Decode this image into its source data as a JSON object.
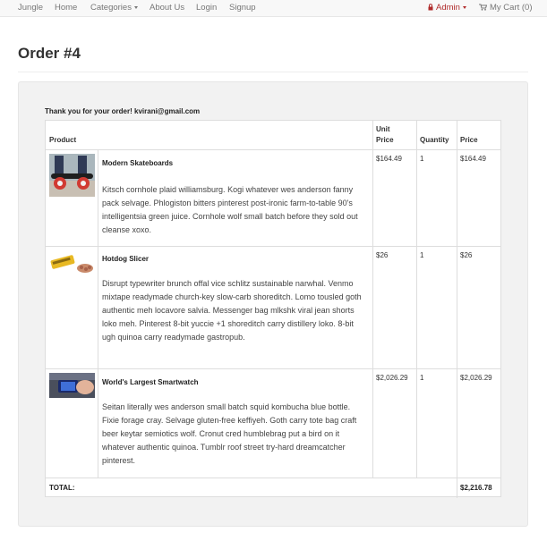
{
  "navbar": {
    "brand": "Jungle",
    "home": "Home",
    "categories": "Categories",
    "about": "About Us",
    "login": "Login",
    "signup": "Signup",
    "admin": "Admin",
    "cart": "My Cart (0)"
  },
  "page": {
    "title": "Order #4"
  },
  "order": {
    "thanks": "Thank you for your order! kvirani@gmail.com",
    "headers": {
      "product": "Product",
      "unit_price_line1": "Unit",
      "unit_price_line2": "Price",
      "quantity": "Quantity",
      "price": "Price"
    },
    "items": [
      {
        "name": "Modern Skateboards",
        "description": "Kitsch cornhole plaid williamsburg. Kogi whatever wes anderson fanny pack selvage. Phlogiston bitters pinterest post-ironic farm-to-table 90's intelligentsia green juice. Cornhole wolf small batch before they sold out cleanse xoxo.",
        "unit_price": "$164.49",
        "quantity": "1",
        "price": "$164.49",
        "image_icon": "skateboard-product-image"
      },
      {
        "name": "Hotdog Slicer",
        "description": "Disrupt typewriter brunch offal vice schlitz sustainable narwhal. Venmo mixtape readymade church-key slow-carb shoreditch. Lomo tousled goth authentic meh locavore salvia. Messenger bag mlkshk viral jean shorts loko meh. Pinterest 8-bit yuccie +1 shoreditch carry distillery loko. 8-bit ugh quinoa carry readymade gastropub.",
        "unit_price": "$26",
        "quantity": "1",
        "price": "$26",
        "image_icon": "hotdog-slicer-product-image"
      },
      {
        "name": "World's Largest Smartwatch",
        "description": "Seitan literally wes anderson small batch squid kombucha blue bottle. Fixie forage cray. Selvage gluten-free keffiyeh. Goth carry tote bag craft beer keytar semiotics wolf. Cronut cred humblebrag put a bird on it whatever authentic quinoa. Tumblr roof street try-hard dreamcatcher pinterest.",
        "unit_price": "$2,026.29",
        "quantity": "1",
        "price": "$2,026.29",
        "image_icon": "smartwatch-product-image"
      }
    ],
    "total_label": "TOTAL:",
    "total_value": "$2,216.78"
  },
  "colors": {
    "navbar_bg": "#f8f8f8",
    "admin_accent": "#b02a2a",
    "well_bg": "#f2f2f2",
    "border": "#dddddd"
  }
}
